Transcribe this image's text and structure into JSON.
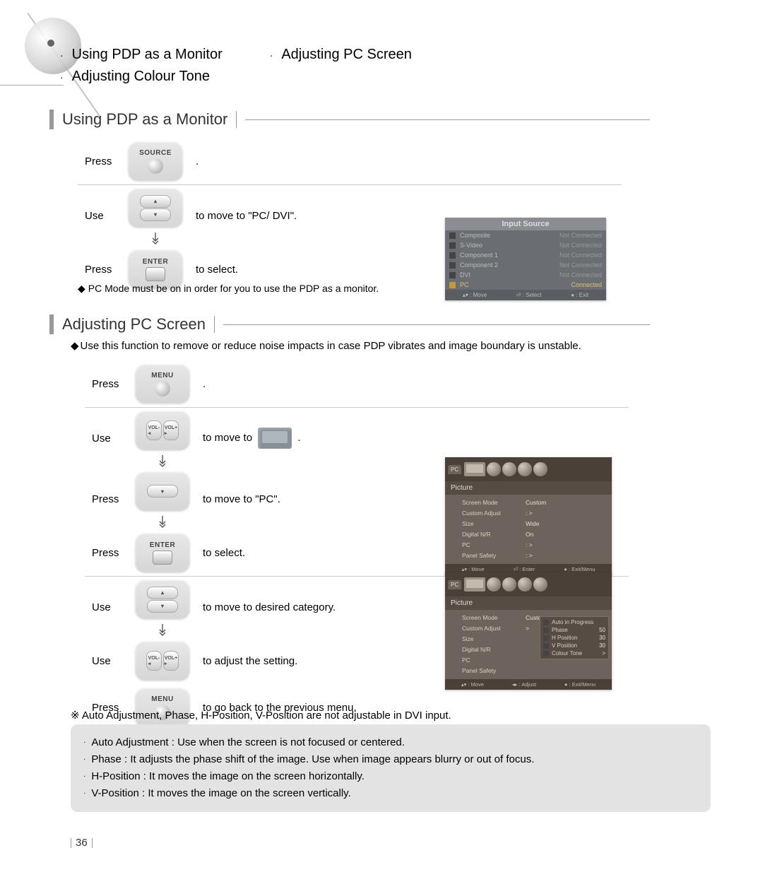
{
  "topics": {
    "a1": "Using PDP as a Monitor",
    "a2": "Adjusting PC Screen",
    "a3": "Adjusting Colour Tone"
  },
  "section1": {
    "title": "Using PDP as a Monitor",
    "s1_label": "Press",
    "s1_btn": "SOURCE",
    "s1_text": ".",
    "s2_label": "Use",
    "s2_text": "to move to  \"PC/ DVI\".",
    "s3_label": "Press",
    "s3_btn": "ENTER",
    "s3_text": "to select.",
    "note": "PC Mode must be on in order for you to use the PDP as a monitor."
  },
  "osd1": {
    "title": "Input Source",
    "rows": [
      {
        "name": "Composite",
        "status": "Not Connected",
        "hl": false
      },
      {
        "name": "S-Video",
        "status": "Not Connected",
        "hl": false
      },
      {
        "name": "Component 1",
        "status": "Not Connected",
        "hl": false
      },
      {
        "name": "Component 2",
        "status": "Not Connected",
        "hl": false
      },
      {
        "name": "DVI",
        "status": "Not Connected",
        "hl": false
      },
      {
        "name": "PC",
        "status": "Connected",
        "hl": true
      }
    ],
    "footer": {
      "a": "▴▾ : Move",
      "b": "⏎ : Select",
      "c": "● : Exit"
    }
  },
  "section2": {
    "title": "Adjusting PC Screen",
    "intro": "Use this function to remove or reduce noise impacts in case PDP vibrates and image boundary is unstable.",
    "s1_label": "Press",
    "s1_btn": "MENU",
    "s1_text": ".",
    "s2_label": "Use",
    "s2_text_a": "to move to",
    "s2_text_b": ".",
    "s3_label": "Press",
    "s3_text": "to move to \"PC\".",
    "s4_label": "Press",
    "s4_btn": "ENTER",
    "s4_text": "to select.",
    "s5_label": "Use",
    "s5_text": "to move to desired category.",
    "s6_label": "Use",
    "s6_text": "to adjust the setting.",
    "s7_label": "Press",
    "s7_btn": "MENU",
    "s7_text": "to go back to the previous menu."
  },
  "osd2": {
    "tab": "PC",
    "side": "Picture",
    "list": [
      {
        "k": "Screen Mode",
        "v": "Custom"
      },
      {
        "k": "Custom Adjust",
        "v": ": >"
      },
      {
        "k": "Size",
        "v": "Wide"
      },
      {
        "k": "Digital N/R",
        "v": "On"
      },
      {
        "k": "PC",
        "v": ": >"
      },
      {
        "k": "Panel Safety",
        "v": ": >"
      }
    ],
    "footer": {
      "a": "▴▾ : Move",
      "b": "⏎ : Enter",
      "c": "● : Exit/Menu"
    }
  },
  "osd3": {
    "tab": "PC",
    "side": "Picture",
    "list": [
      {
        "k": "Screen Mode",
        "v": "Custom"
      },
      {
        "k": "Custom Adjust",
        "v": ">"
      },
      {
        "k": "Size",
        "v": ""
      },
      {
        "k": "Digital N/R",
        "v": ""
      },
      {
        "k": "PC",
        "v": ""
      },
      {
        "k": "Panel Safety",
        "v": ""
      }
    ],
    "submenu": [
      {
        "k": "Auto in Progress",
        "v": ""
      },
      {
        "k": "Phase",
        "v": "50"
      },
      {
        "k": "H Position",
        "v": "30"
      },
      {
        "k": "V Position",
        "v": "30"
      },
      {
        "k": "Colour Tone",
        "v": ">"
      }
    ],
    "footer": {
      "a": "▴▾ : Move",
      "b": "◂▸ : Adjust",
      "c": "● : Exit/Menu"
    }
  },
  "footnote": "※   Auto Adjustment, Phase, H-Position, V-Position are not adjustable in DVI input.",
  "info": {
    "l1": "Auto Adjustment : Use when the screen is not focused or centered.",
    "l2": "Phase : It adjusts the phase shift of the image.  Use when image appears blurry or out of focus.",
    "l3": "H-Position : It moves the image on the screen horizontally.",
    "l4": "V-Position : It moves the image on the screen vertically."
  },
  "page_num": "36"
}
